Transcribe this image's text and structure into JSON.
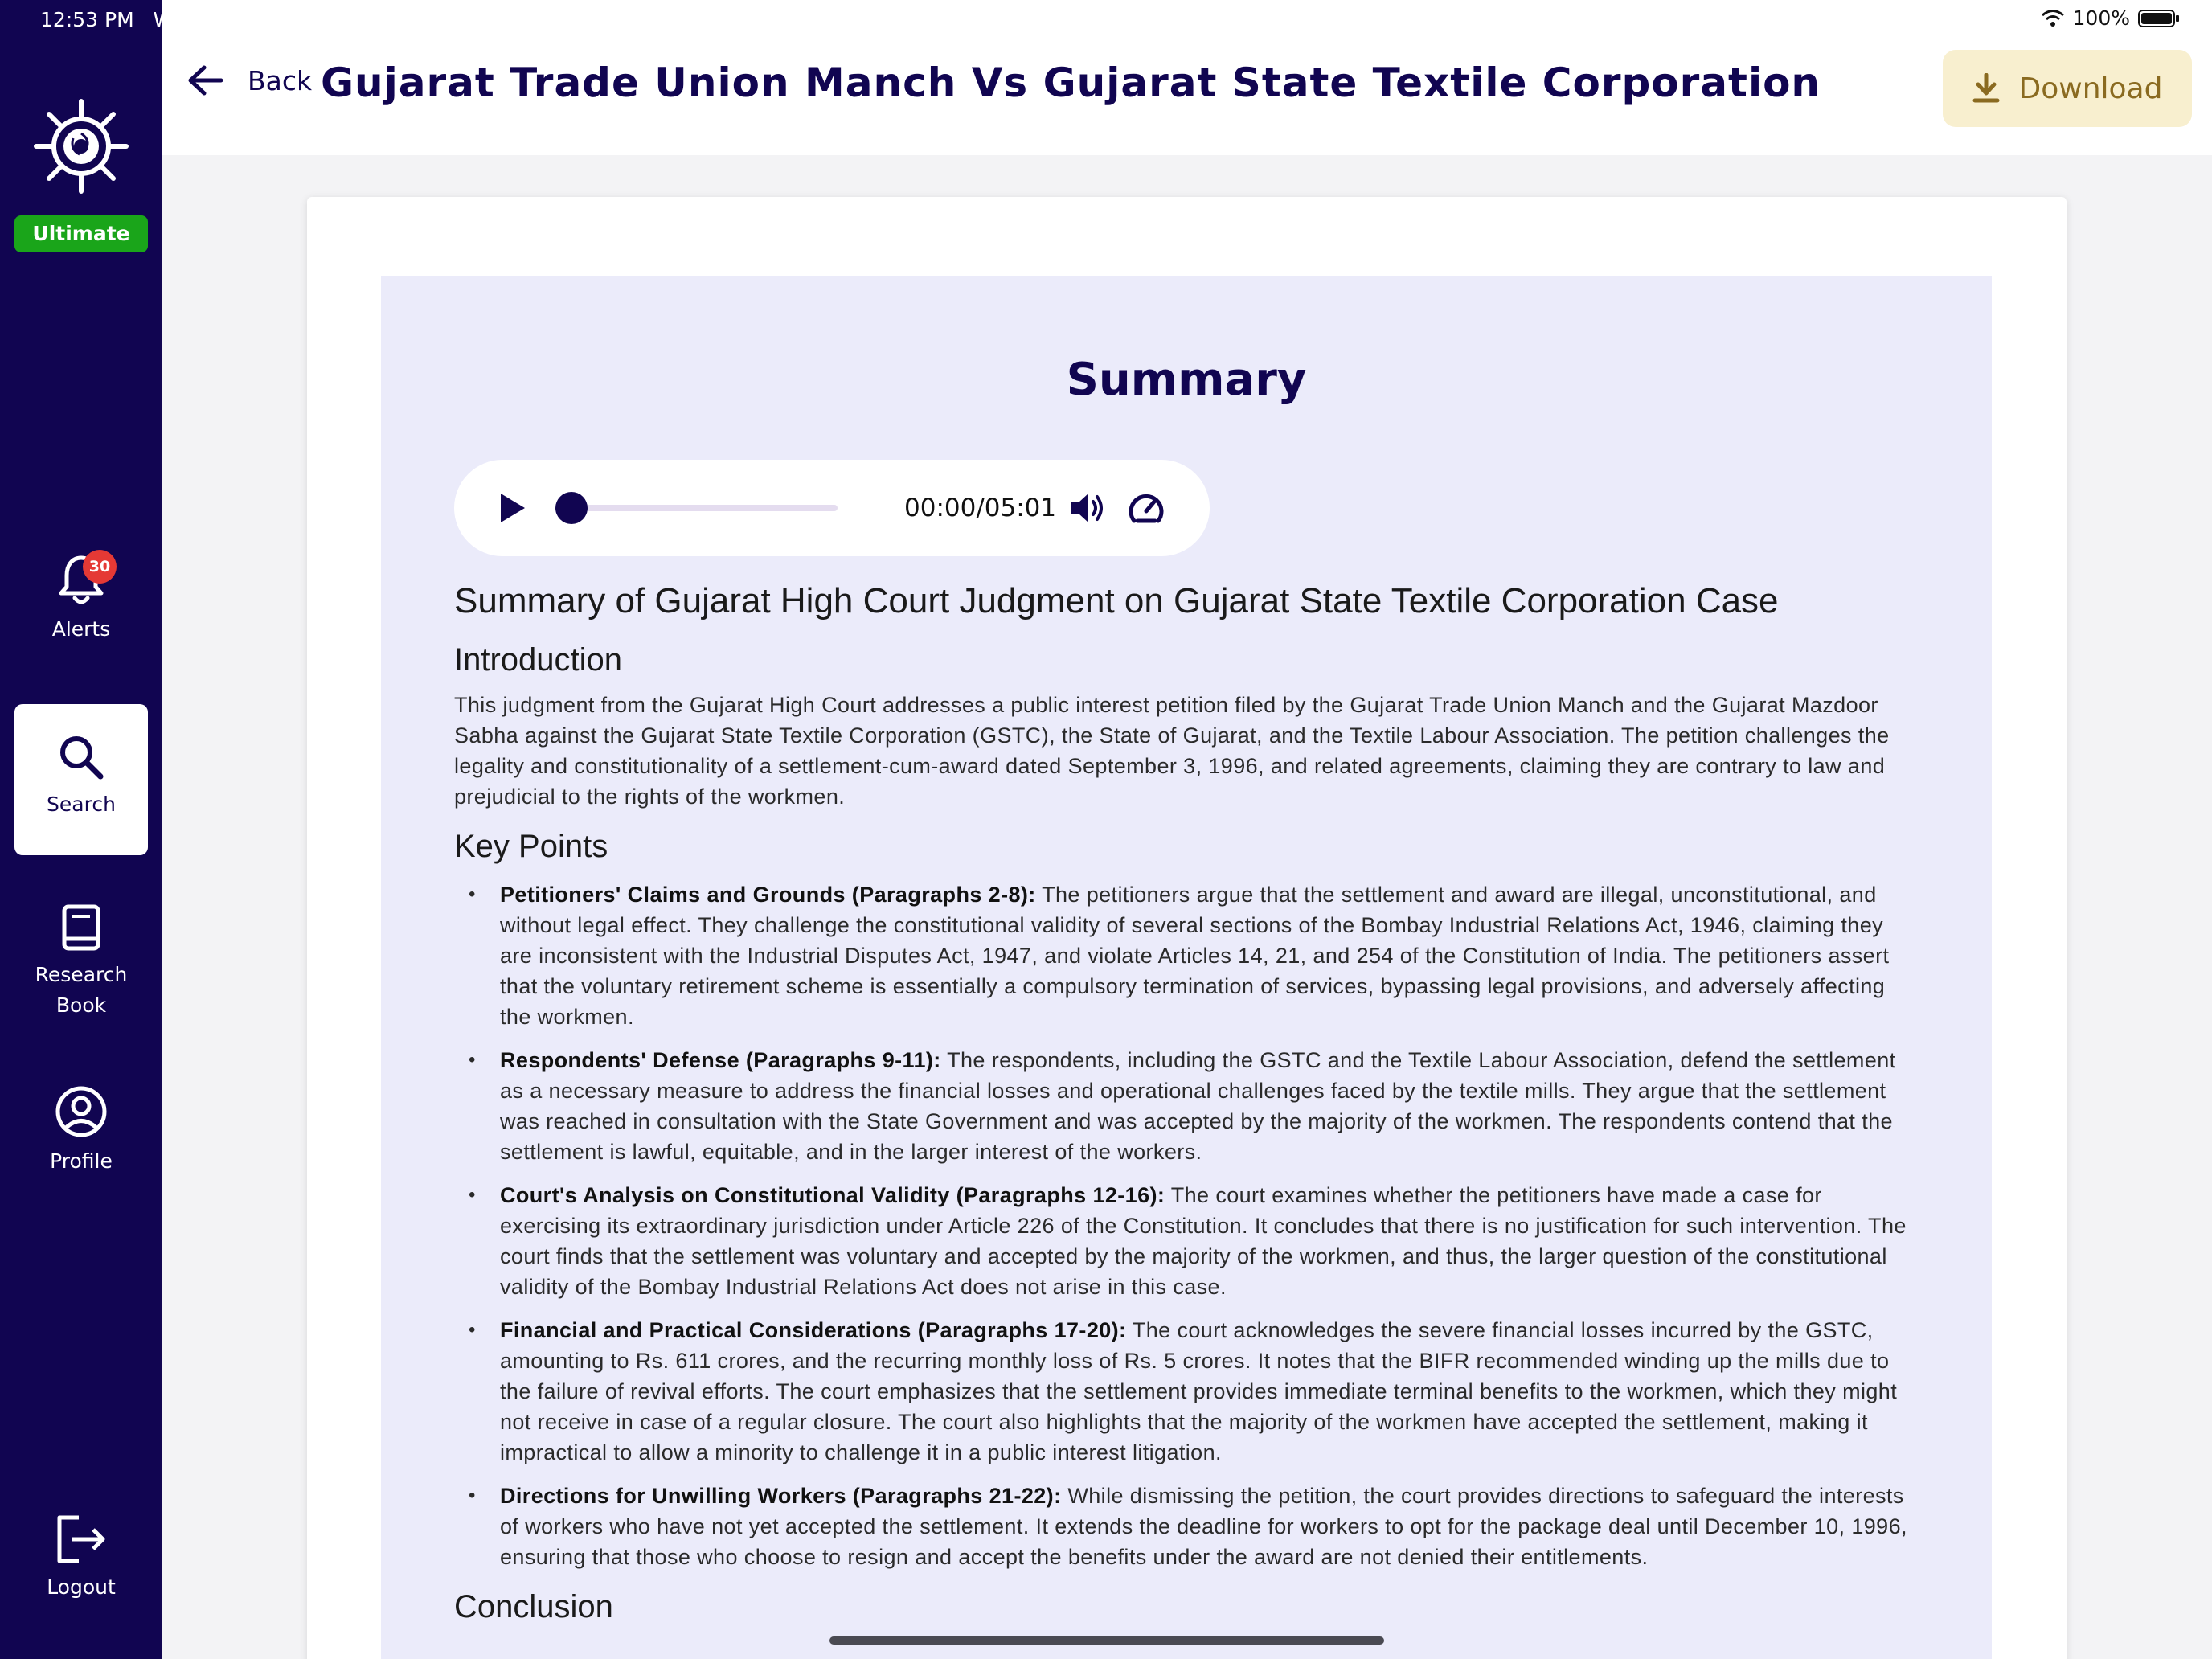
{
  "status": {
    "time": "12:53 PM",
    "time_extra": "Wed",
    "battery": "100%"
  },
  "sidebar": {
    "plan": "Ultimate",
    "items": [
      {
        "label": "Alerts",
        "badge": "30"
      },
      {
        "label": "Search"
      },
      {
        "label": "Research Book"
      },
      {
        "label": "Profile"
      },
      {
        "label": "Logout"
      }
    ]
  },
  "header": {
    "back_label": "Back",
    "title": "Gujarat Trade Union Manch Vs Gujarat State Textile Corporation",
    "download_label": "Download"
  },
  "summary": {
    "heading": "Summary",
    "audio": {
      "time": "00:00/05:01",
      "progress": 0
    },
    "doc_title": "Summary of Gujarat High Court Judgment on Gujarat State Textile Corporation Case",
    "intro_heading": "Introduction",
    "intro_text": "This judgment from the Gujarat High Court addresses a public interest petition filed by the Gujarat Trade Union Manch and the Gujarat Mazdoor Sabha against the Gujarat State Textile Corporation (GSTC), the State of Gujarat, and the Textile Labour Association. The petition challenges the legality and constitutionality of a settlement-cum-award dated September 3, 1996, and related agreements, claiming they are contrary to law and prejudicial to the rights of the workmen.",
    "key_points_heading": "Key Points",
    "key_points": [
      {
        "title": "Petitioners' Claims and Grounds (Paragraphs 2-8):",
        "text": " The petitioners argue that the settlement and award are illegal, unconstitutional, and without legal effect. They challenge the constitutional validity of several sections of the Bombay Industrial Relations Act, 1946, claiming they are inconsistent with the Industrial Disputes Act, 1947, and violate Articles 14, 21, and 254 of the Constitution of India. The petitioners assert that the voluntary retirement scheme is essentially a compulsory termination of services, bypassing legal provisions, and adversely affecting the workmen."
      },
      {
        "title": "Respondents' Defense (Paragraphs 9-11):",
        "text": " The respondents, including the GSTC and the Textile Labour Association, defend the settlement as a necessary measure to address the financial losses and operational challenges faced by the textile mills. They argue that the settlement was reached in consultation with the State Government and was accepted by the majority of the workmen. The respondents contend that the settlement is lawful, equitable, and in the larger interest of the workers."
      },
      {
        "title": "Court's Analysis on Constitutional Validity (Paragraphs 12-16):",
        "text": " The court examines whether the petitioners have made a case for exercising its extraordinary jurisdiction under Article 226 of the Constitution. It concludes that there is no justification for such intervention. The court finds that the settlement was voluntary and accepted by the majority of the workmen, and thus, the larger question of the constitutional validity of the Bombay Industrial Relations Act does not arise in this case."
      },
      {
        "title": "Financial and Practical Considerations (Paragraphs 17-20):",
        "text": " The court acknowledges the severe financial losses incurred by the GSTC, amounting to Rs. 611 crores, and the recurring monthly loss of Rs. 5 crores. It notes that the BIFR recommended winding up the mills due to the failure of revival efforts. The court emphasizes that the settlement provides immediate terminal benefits to the workmen, which they might not receive in case of a regular closure. The court also highlights that the majority of the workmen have accepted the settlement, making it impractical to allow a minority to challenge it in a public interest litigation."
      },
      {
        "title": "Directions for Unwilling Workers (Paragraphs 21-22):",
        "text": " While dismissing the petition, the court provides directions to safeguard the interests of workers who have not yet accepted the settlement. It extends the deadline for workers to opt for the package deal until December 10, 1996, ensuring that those who choose to resign and accept the benefits under the award are not denied their entitlements."
      }
    ],
    "conclusion_heading": "Conclusion"
  }
}
